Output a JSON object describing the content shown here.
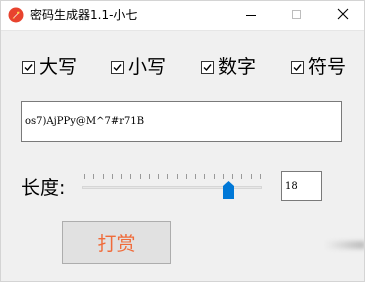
{
  "window": {
    "title": "密码生成器1.1-小七",
    "app_icon": "rocket-icon",
    "controls": [
      "minimize",
      "maximize",
      "close"
    ]
  },
  "options": [
    {
      "label": "大写",
      "checked": true
    },
    {
      "label": "小写",
      "checked": true
    },
    {
      "label": "数字",
      "checked": true
    },
    {
      "label": "符号",
      "checked": true
    }
  ],
  "password": {
    "value": "os7)AjPPy@M^7#r71B"
  },
  "length": {
    "label": "长度:",
    "value": "18",
    "slider_fraction": 0.82,
    "tick_count": 20
  },
  "donate": {
    "label": "打赏",
    "color": "#f06b3a"
  },
  "colors": {
    "accent": "#0078d7"
  }
}
